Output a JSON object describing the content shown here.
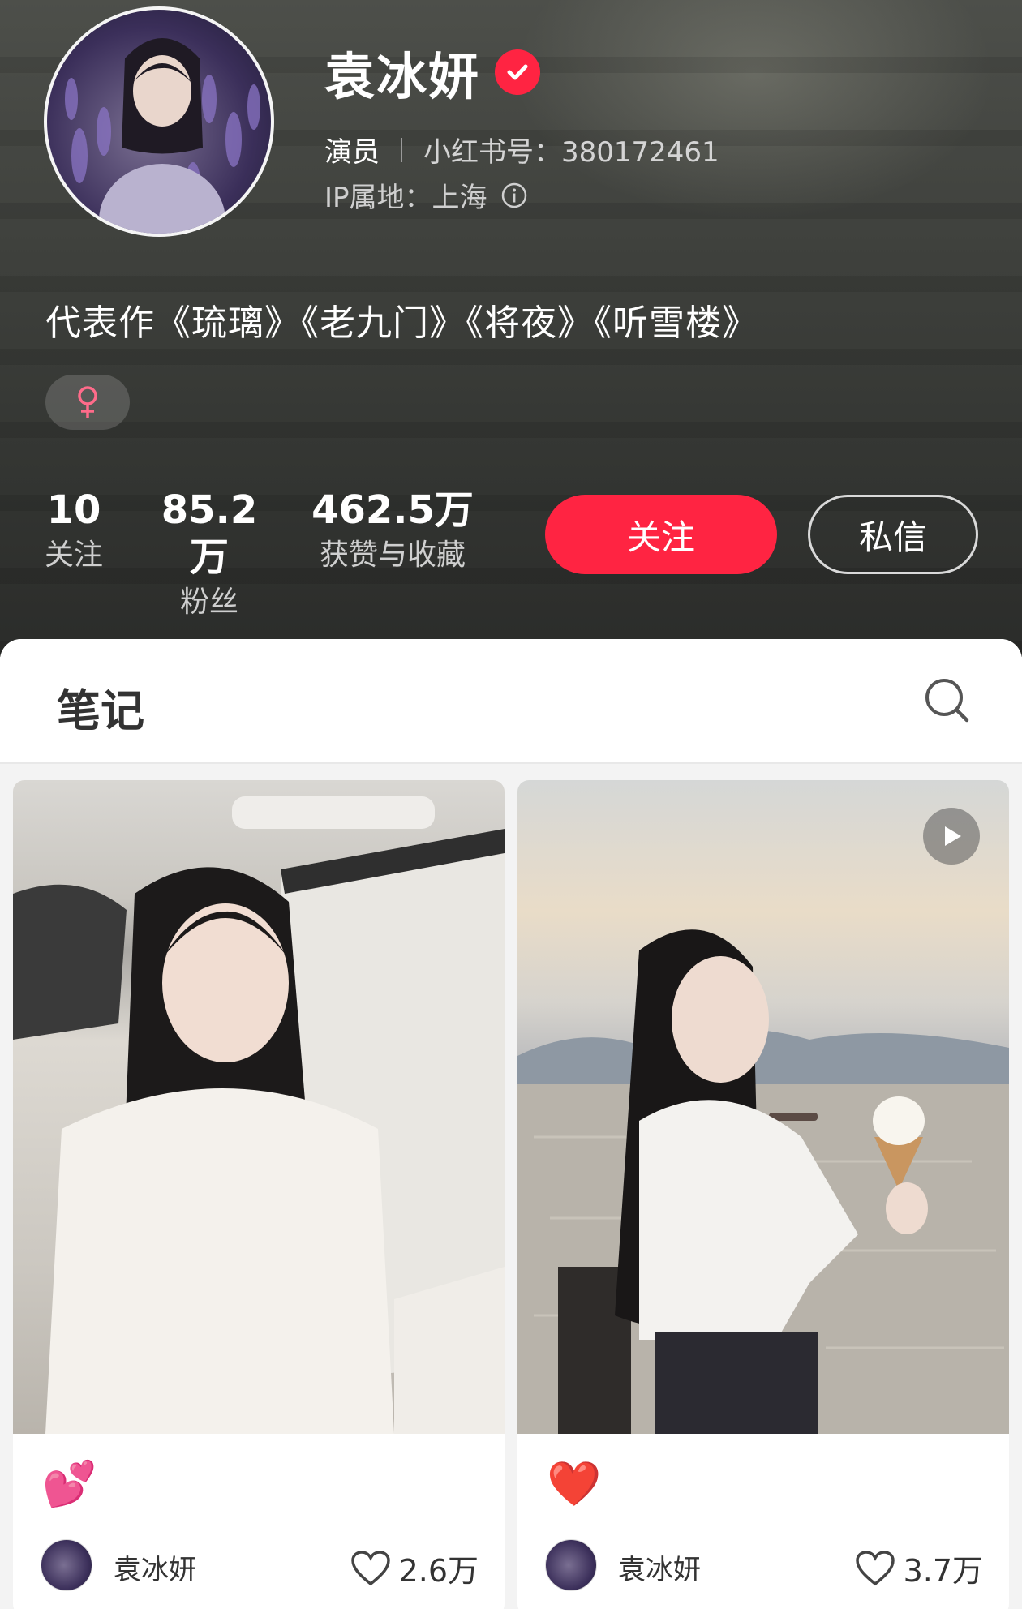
{
  "profile": {
    "name": "袁冰妍",
    "role": "演员",
    "red_id": "小红书号：380172461",
    "ip_location": "IP属地：上海",
    "bio": "代表作《琉璃》《老九门》《将夜》《听雪楼》",
    "gender_symbol": "♀",
    "verified_icon": "verified-check-icon"
  },
  "stats": [
    {
      "value": "10",
      "label": "关注"
    },
    {
      "value": "85.2万",
      "label": "粉丝"
    },
    {
      "value": "462.5万",
      "label": "获赞与收藏"
    }
  ],
  "actions": {
    "follow_label": "关注",
    "message_label": "私信"
  },
  "notes_tab": {
    "label": "笔记",
    "search_icon": "search-icon"
  },
  "notes": [
    {
      "emoji": "💕",
      "author": "袁冰妍",
      "likes": "2.6万",
      "is_video": false
    },
    {
      "emoji": "❤️",
      "author": "袁冰妍",
      "likes": "3.7万",
      "is_video": true
    }
  ],
  "colors": {
    "accent": "#ff2442",
    "header_bg": "#3e403c"
  }
}
